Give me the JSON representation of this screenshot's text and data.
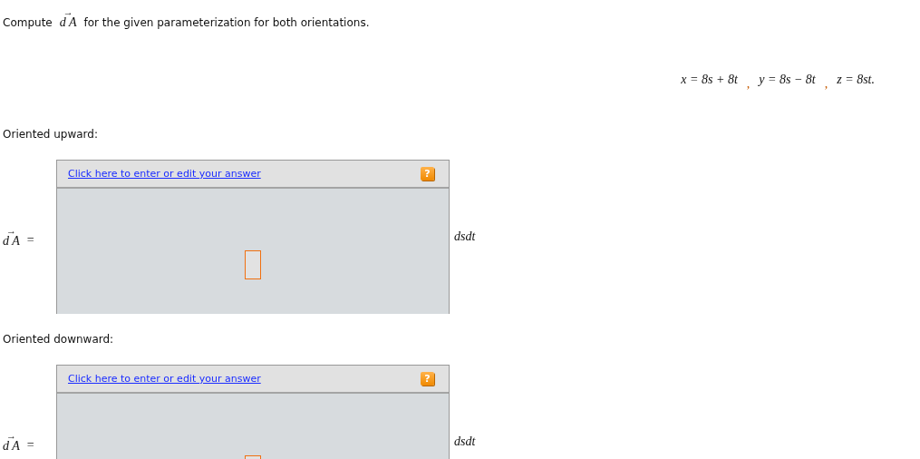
{
  "prompt": {
    "before": "Compute",
    "arrow": "→",
    "symbol": "d A",
    "after": "for the given parameterization for both orientations."
  },
  "equations": [
    {
      "text": "x = 8s + 8t",
      "separator": ","
    },
    {
      "text": "y = 8s − 8t",
      "separator": ","
    },
    {
      "text": "z = 8st."
    }
  ],
  "sections": [
    {
      "label": "Oriented upward:",
      "arrow": "→",
      "symbol": "d A",
      "equals": "=",
      "link": "Click here to enter or edit your answer",
      "help": "?",
      "unit": "dsdt"
    },
    {
      "label": "Oriented downward:",
      "arrow": "→",
      "symbol": "d A",
      "equals": "=",
      "link": "Click here to enter or edit your answer",
      "help": "?",
      "unit": "dsdt"
    }
  ]
}
